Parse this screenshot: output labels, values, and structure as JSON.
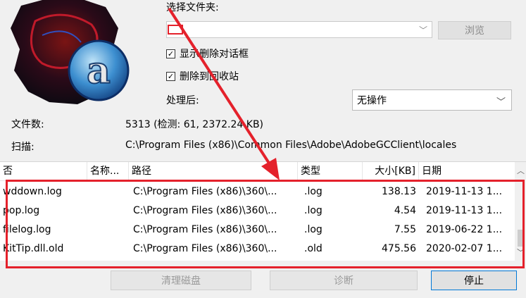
{
  "labels": {
    "select_folder": "选择文件夹:",
    "show_delete_dialog": "显示删除对话框",
    "delete_to_recycle": "删除到回收站",
    "after_process": "处理后:",
    "file_count_label": "文件数:",
    "scan_label": "扫描:"
  },
  "buttons": {
    "browse": "浏览",
    "clean_disk": "清理磁盘",
    "diagnose": "诊断",
    "stop": "停止"
  },
  "after_process_value": "无操作",
  "file_count_value": "5313 (检测: 61, 2372.24 KB)",
  "scan_path": "C:\\Program Files (x86)\\Common Files\\Adobe\\AdobeGCClient\\locales",
  "table": {
    "headers": [
      "否",
      "名称...",
      "路径",
      "类型",
      "大小[KB]",
      "日期"
    ],
    "rows": [
      {
        "name": "wddown.log",
        "path": "C:\\Program Files (x86)\\360\\...",
        "type": ".log",
        "size": "138.13",
        "date": "2019-11-13 1..."
      },
      {
        "name": "pop.log",
        "path": "C:\\Program Files (x86)\\360\\...",
        "type": ".log",
        "size": "4.54",
        "date": "2019-11-13 1..."
      },
      {
        "name": "filelog.log",
        "path": "C:\\Program Files (x86)\\360\\...",
        "type": ".log",
        "size": "7.55",
        "date": "2019-06-22 1..."
      },
      {
        "name": "KitTip.dll.old",
        "path": "C:\\Program Files (x86)\\360\\...",
        "type": ".old",
        "size": "475.56",
        "date": "2020-02-07 1..."
      }
    ]
  },
  "colors": {
    "annotation_red": "#e4212b",
    "focus_blue": "#0078d7"
  },
  "icons": [
    "app-logo-icon",
    "chevron-down-icon",
    "checkmark-icon",
    "scroll-up-icon",
    "scroll-down-icon",
    "annotation-arrow-icon"
  ]
}
